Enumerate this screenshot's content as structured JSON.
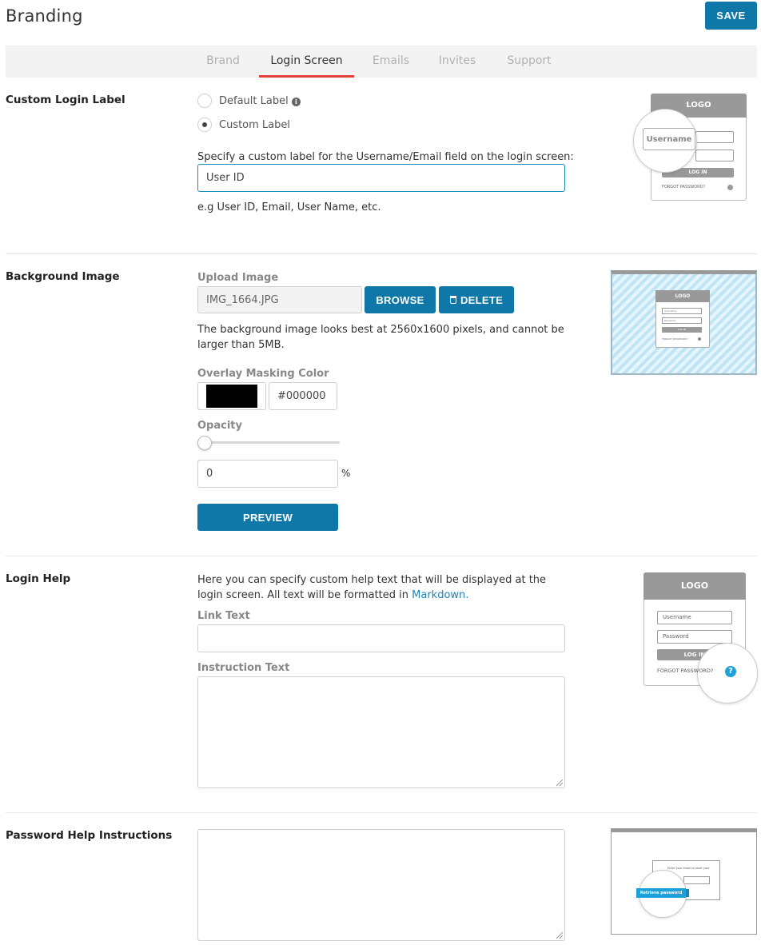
{
  "header": {
    "title": "Branding",
    "save_label": "SAVE"
  },
  "tabs": [
    {
      "label": "Brand",
      "active": false
    },
    {
      "label": "Login Screen",
      "active": true
    },
    {
      "label": "Emails",
      "active": false
    },
    {
      "label": "Invites",
      "active": false
    },
    {
      "label": "Support",
      "active": false
    }
  ],
  "custom_login_label": {
    "title": "Custom Login Label",
    "options": [
      {
        "label": "Default Label",
        "selected": false,
        "info_icon": "info-circle-icon"
      },
      {
        "label": "Custom Label",
        "selected": true
      }
    ],
    "prompt": "Specify a custom label for the Username/Email field on the login screen:",
    "value": "User ID",
    "hint": "e.g User ID, Email, User Name, etc.",
    "preview": {
      "logo": "LOGO",
      "username": "Username",
      "login": "LOG IN",
      "forgot": "FORGOT PASSWORD?"
    }
  },
  "background_image": {
    "title": "Background Image",
    "upload_label": "Upload Image",
    "file_name": "IMG_1664.JPG",
    "browse_label": "BROWSE",
    "delete_label": "DELETE",
    "description": "The background image looks best at 2560x1600 pixels, and cannot be larger than 5MB.",
    "overlay_label": "Overlay Masking Color",
    "overlay_color": "#000000",
    "overlay_color_text": "#000000",
    "opacity_label": "Opacity",
    "opacity_value": "0",
    "opacity_fraction": 0,
    "opacity_unit": "%",
    "preview_label": "PREVIEW",
    "preview": {
      "logo": "LOGO",
      "username": "Username",
      "password": "Password",
      "login": "LOG IN",
      "forgot": "FORGOT PASSWORD?"
    }
  },
  "login_help": {
    "title": "Login Help",
    "description": "Here you can specify custom help text that will be displayed at the login screen. All text will be formatted in",
    "markdown_link": "Markdown.",
    "link_text_label": "Link Text",
    "link_text_value": "",
    "instruction_label": "Instruction Text",
    "instruction_value": "",
    "preview": {
      "logo": "LOGO",
      "username": "Username",
      "password": "Password",
      "login": "LOG IN",
      "forgot": "FORGOT PASSWORD?",
      "help_icon": "question-circle-icon"
    }
  },
  "password_help": {
    "title": "Password Help Instructions",
    "value": "",
    "preview": {
      "retrieve": "Retrieve password",
      "email_prompt": "Enter your email to reset your"
    }
  },
  "colors": {
    "accent": "#0f78a8",
    "tab_underline": "#e0413a",
    "help_blue": "#1da1d8"
  }
}
